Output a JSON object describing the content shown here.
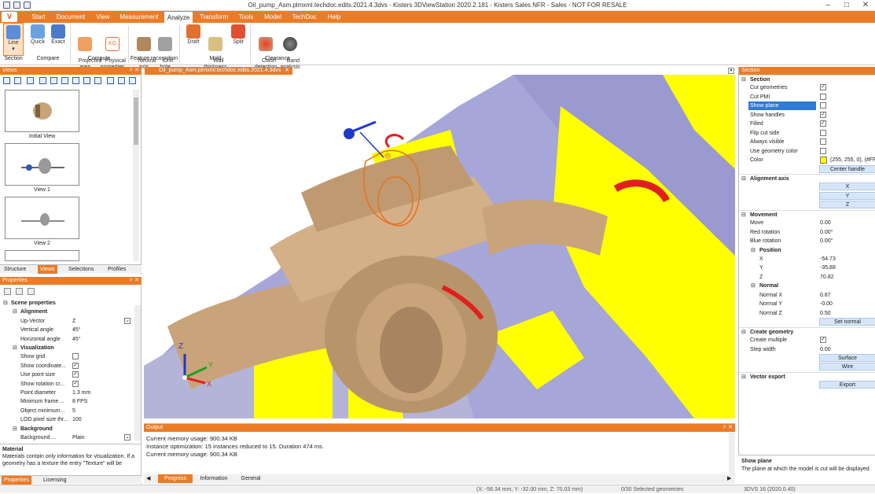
{
  "window": {
    "title": "Oil_pump_Asm.plmxml.techdoc.edits.2021.4.3dvs - Kisters 3DViewStation 2020.2.181 - Kisters Sales NFR - Sales - NOT FOR RESALE",
    "minimize": "–",
    "maximize": "□",
    "close": "✕"
  },
  "menu": {
    "logo": "V",
    "items": [
      "Start",
      "Document",
      "View",
      "Measurement",
      "Analyze",
      "Transform",
      "Tools",
      "Model",
      "TechDoc",
      "Help"
    ],
    "active": "Analyze"
  },
  "ribbon": {
    "buttons": [
      {
        "label": "Line",
        "sub": "▾"
      },
      {
        "label": "Quick"
      },
      {
        "label": "Exact"
      },
      {
        "label": "Projected\narea"
      },
      {
        "label": "Physical\nproperties"
      },
      {
        "label": "Neutral\naxis"
      },
      {
        "label": "Drill\nhole"
      },
      {
        "label": "Draft"
      },
      {
        "label": "Wall\nthickness"
      },
      {
        "label": "Split"
      },
      {
        "label": "Clash\ndetection"
      },
      {
        "label": "Band\nanalysis"
      }
    ],
    "groups": [
      "Section",
      "Compare",
      "Compute",
      "Feature recognition",
      "Mold",
      "Clearance"
    ]
  },
  "views_panel": {
    "title": "Views",
    "pin": "ᵖ",
    "close": "✕",
    "thumbnails": [
      "Initial View",
      "View 1",
      "View 2"
    ],
    "tabs": [
      "Structure",
      "Views",
      "Selections",
      "Profiles"
    ],
    "active_tab": "Views"
  },
  "properties_panel": {
    "title": "Properties",
    "rows": [
      {
        "label": "Scene properties",
        "type": "group"
      },
      {
        "label": "Alignment",
        "type": "subgroup"
      },
      {
        "label": "Up-Vector",
        "value": "Z",
        "dropdown": "⌄"
      },
      {
        "label": "Vertical angle",
        "value": "45°"
      },
      {
        "label": "Horizontal angle",
        "value": "45°"
      },
      {
        "label": "Visualization",
        "type": "subgroup"
      },
      {
        "label": "Show grid",
        "check": false
      },
      {
        "label": "Show coordinate...",
        "check": true
      },
      {
        "label": "Use point size",
        "check": true
      },
      {
        "label": "Show rotation cr...",
        "check": true
      },
      {
        "label": "Point diameter",
        "value": "1.3 mm"
      },
      {
        "label": "Minimum frame ...",
        "value": "8 FPS"
      },
      {
        "label": "Object minimum...",
        "value": "5"
      },
      {
        "label": "LOD pixel size thr...",
        "value": "100"
      },
      {
        "label": "Background",
        "type": "subgroup"
      },
      {
        "label": "Background ...",
        "value": "Plain",
        "dropdown": "⌄"
      }
    ],
    "help_title": "Material",
    "help_text": "Materials contain only information for visualization. If a geometry has a texture the entry \"Texture\" will be",
    "tabs": [
      "Properties",
      "Licensing"
    ],
    "active_tab": "Properties"
  },
  "document_tab": {
    "title": "Oil_pump_Asm.plmxml.techdoc.edits.2021.4.3dvs",
    "close": "✕"
  },
  "viewport": {
    "axes": {
      "x": "X",
      "y": "Y",
      "z": "Z"
    }
  },
  "output_panel": {
    "title": "Output",
    "lines": [
      "Current memory usage: 900.34 KB",
      "Instance optimization: 15 instances reduced to 15. Duration 474 ms.",
      "Current memory usage: 900.34 KB"
    ],
    "tabs": [
      "Progress",
      "Information",
      "General"
    ],
    "active_tab": "Progress"
  },
  "section_panel": {
    "title": "Section",
    "rows": [
      {
        "label": "Section",
        "type": "group"
      },
      {
        "label": "Cut geometries",
        "check": true
      },
      {
        "label": "Cut PMI",
        "check": false
      },
      {
        "label": "Show plane",
        "check": false,
        "highlight": true
      },
      {
        "label": "Show handles",
        "check": true
      },
      {
        "label": "Filled",
        "check": true
      },
      {
        "label": "Flip cut side",
        "check": false
      },
      {
        "label": "Always visible",
        "check": false
      },
      {
        "label": "Use geometry color",
        "check": false
      },
      {
        "label": "Color",
        "value": "(255, 255, 0), (#FFF",
        "swatch": "#ffff00"
      },
      {
        "button": "Center handle"
      },
      {
        "label": "Alignment axis",
        "type": "group"
      },
      {
        "button": "X"
      },
      {
        "button": "Y"
      },
      {
        "button": "Z"
      },
      {
        "label": "Movement",
        "type": "group"
      },
      {
        "label": "Move",
        "value": "0.00"
      },
      {
        "label": "Red rotation",
        "value": "0.00°"
      },
      {
        "label": "Blue rotation",
        "value": "0.00°"
      },
      {
        "label": "Position",
        "type": "subgroup"
      },
      {
        "label": "X",
        "value": "-54.73",
        "indent": true
      },
      {
        "label": "Y",
        "value": "-35.88",
        "indent": true
      },
      {
        "label": "Z",
        "value": "70.82",
        "indent": true
      },
      {
        "label": "Normal",
        "type": "subgroup"
      },
      {
        "label": "Normal X",
        "value": "0.87",
        "indent": true
      },
      {
        "label": "Normal Y",
        "value": "-0.00",
        "indent": true
      },
      {
        "label": "Normal Z",
        "value": "0.50",
        "indent": true
      },
      {
        "button": "Set normal"
      },
      {
        "label": "Create geometry",
        "type": "group"
      },
      {
        "label": "Create multiple",
        "check": true
      },
      {
        "label": "Step width",
        "value": "0.00"
      },
      {
        "button": "Surface"
      },
      {
        "button": "Wire"
      },
      {
        "label": "Vector export",
        "type": "group"
      },
      {
        "button": "Export"
      }
    ],
    "help_title": "Show plane",
    "help_text": "The plane at which the model is cut will be displayed."
  },
  "status": {
    "coords": "(X: -56.34 mm, Y: -32.00 mm, Z: 70.03 mm)",
    "selection": "0/30 Selected geometries",
    "version": "3DVS 16 (2020.0.40)"
  },
  "colors": {
    "accent": "#ec7b26",
    "cut_fill": "#ffff00",
    "part_tan": "#c9a47a",
    "part_lavender": "#a6a6d8",
    "highlight": "#2e7ad6"
  }
}
